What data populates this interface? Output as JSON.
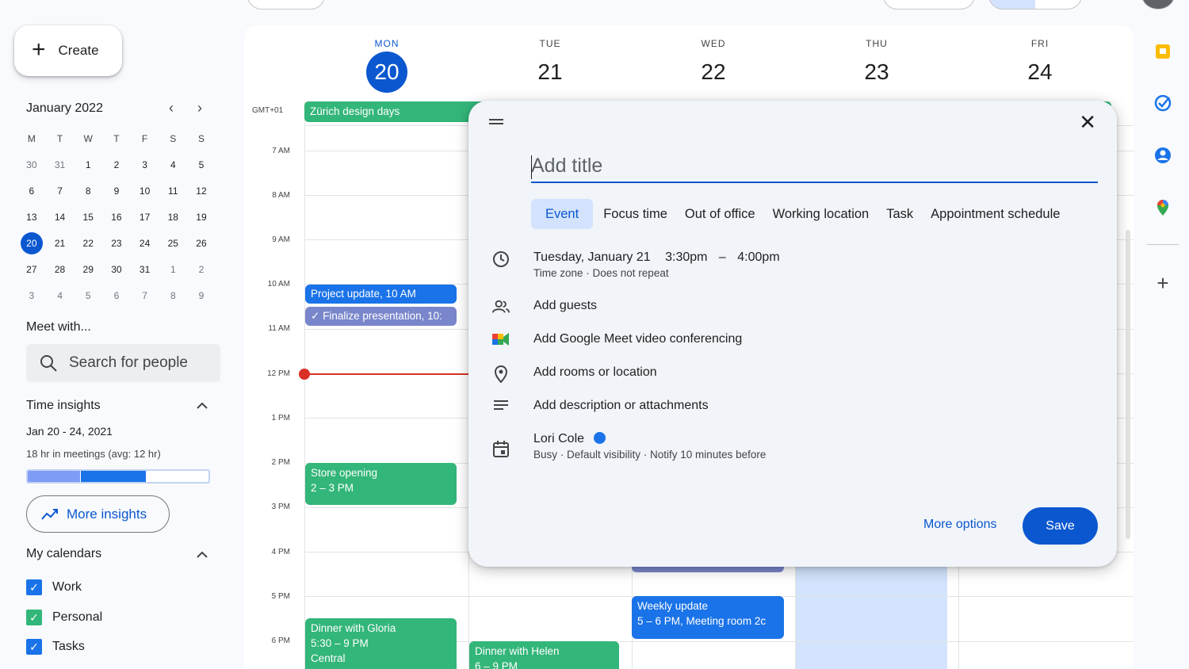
{
  "sidebar": {
    "create_label": "Create",
    "mini_calendar": {
      "month_label": "January 2022",
      "weekdays": [
        "M",
        "T",
        "W",
        "T",
        "F",
        "S",
        "S"
      ],
      "weeks": [
        [
          "30",
          "31",
          "1",
          "2",
          "3",
          "4",
          "5"
        ],
        [
          "6",
          "7",
          "8",
          "9",
          "10",
          "11",
          "12"
        ],
        [
          "13",
          "14",
          "15",
          "16",
          "17",
          "18",
          "19"
        ],
        [
          "20",
          "21",
          "22",
          "23",
          "24",
          "25",
          "26"
        ],
        [
          "27",
          "28",
          "29",
          "30",
          "31",
          "1",
          "2"
        ],
        [
          "3",
          "4",
          "5",
          "6",
          "7",
          "8",
          "9"
        ]
      ],
      "selected_day": "20"
    },
    "meet_with_title": "Meet with...",
    "search_people_placeholder": "Search for people",
    "time_insights": {
      "title": "Time insights",
      "dates": "Jan 20 - 24, 2021",
      "meetings": "18 hr in meetings (avg: 12 hr)",
      "more_insights_label": "More insights"
    },
    "my_calendars": {
      "title": "My calendars",
      "items": [
        {
          "label": "Work",
          "color": "#1a73e8"
        },
        {
          "label": "Personal",
          "color": "#33b679"
        },
        {
          "label": "Tasks",
          "color": "#1a73e8"
        }
      ]
    }
  },
  "calendar": {
    "timezone": "GMT+01",
    "days": [
      {
        "name": "MON",
        "date": "20"
      },
      {
        "name": "TUE",
        "date": "21"
      },
      {
        "name": "WED",
        "date": "22"
      },
      {
        "name": "THU",
        "date": "23"
      },
      {
        "name": "FRI",
        "date": "24"
      }
    ],
    "hours": [
      "7 AM",
      "8 AM",
      "9 AM",
      "10 AM",
      "11 AM",
      "12 PM",
      "1 PM",
      "2 PM",
      "3 PM",
      "4 PM",
      "5 PM",
      "6 PM"
    ],
    "events": {
      "zurich": "Zürich design days",
      "project_update": "Project update, 10 AM",
      "finalize": "Finalize presentation, 10:",
      "store_title": "Store opening",
      "store_time": "2 – 3 PM",
      "gloria_title": "Dinner with Gloria",
      "gloria_time": "5:30 – 9 PM",
      "gloria_place": "Central",
      "helen_title": "Dinner with Helen",
      "helen_time": "6 – 9 PM",
      "weekly_title": "Weekly update",
      "weekly_time": "5 – 6 PM, Meeting room 2c"
    }
  },
  "dialog": {
    "title_placeholder": "Add title",
    "types": [
      "Event",
      "Focus time",
      "Out of office",
      "Working location",
      "Task",
      "Appointment schedule"
    ],
    "active_type": "Event",
    "date": "Tuesday, January 21",
    "start_time": "3:30pm",
    "dash": "–",
    "end_time": "4:00pm",
    "time_sub": "Time zone · Does not repeat",
    "add_guests": "Add guests",
    "add_meet": "Add Google Meet video conferencing",
    "add_location": "Add rooms or location",
    "add_description": "Add description or attachments",
    "owner": "Lori Cole",
    "owner_color": "#1a73e8",
    "owner_sub": "Busy · Default visibility · Notify 10 minutes before",
    "more_options": "More options",
    "save": "Save"
  }
}
